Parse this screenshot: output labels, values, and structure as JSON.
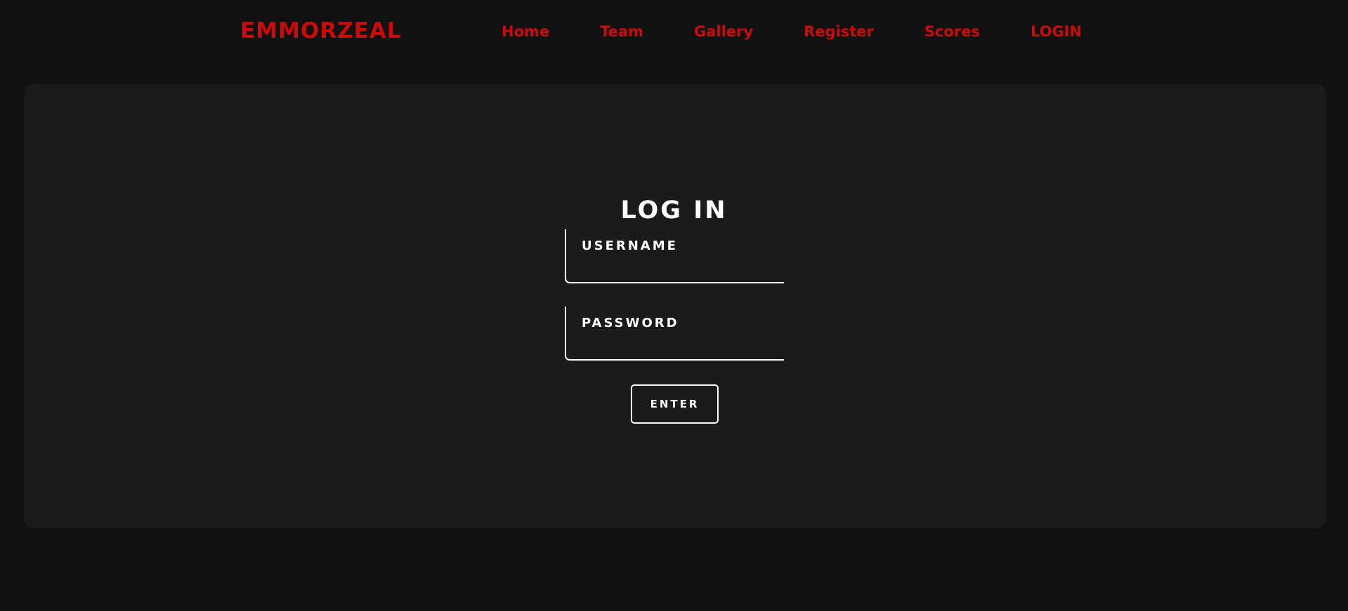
{
  "brand": {
    "name": "EMMORZEAL",
    "color": "#cc0a0a"
  },
  "nav": {
    "items": [
      {
        "label": "Home"
      },
      {
        "label": "Team"
      },
      {
        "label": "Gallery"
      },
      {
        "label": "Register"
      },
      {
        "label": "Scores"
      },
      {
        "label": "LOGIN"
      }
    ],
    "color": "#cc0a0a"
  },
  "login": {
    "title": "LOG IN",
    "username": {
      "label": "USERNAME",
      "value": ""
    },
    "password": {
      "label": "PASSWORD",
      "value": ""
    },
    "submit_label": "ENTER"
  },
  "colors": {
    "page_background": "#111111",
    "panel_background": "#1b1b1b",
    "accent": "#cc0a0a",
    "text": "#ffffff"
  }
}
